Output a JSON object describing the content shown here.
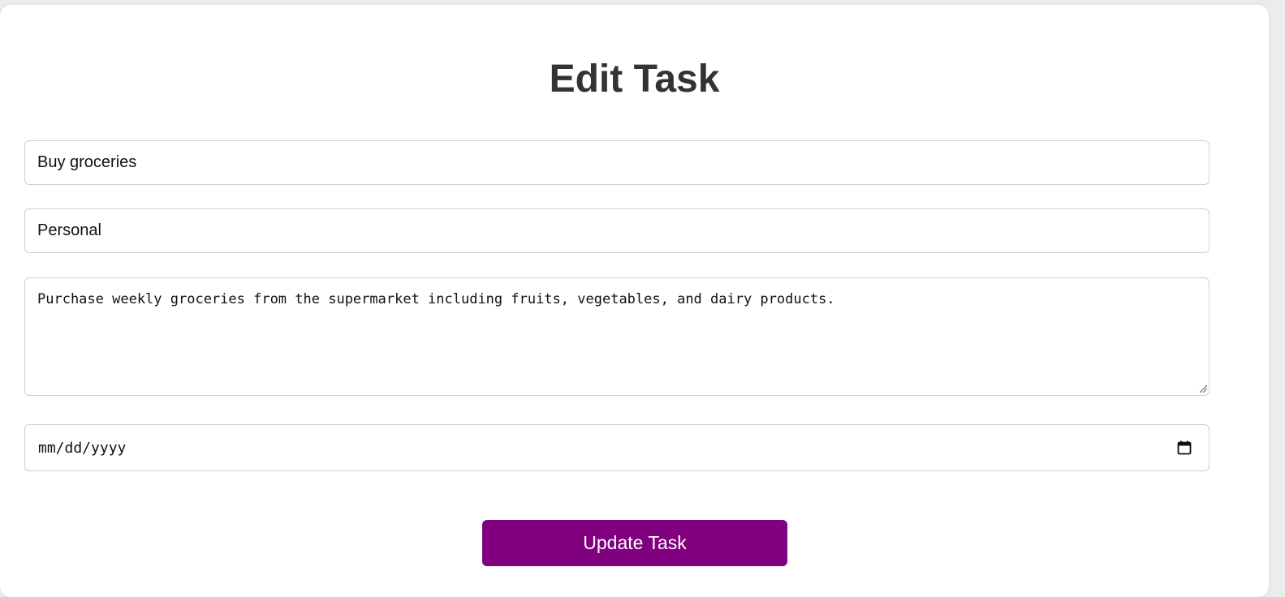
{
  "page": {
    "title": "Edit Task"
  },
  "form": {
    "task_title_value": "Buy groceries",
    "category_value": "Personal",
    "description_value": "Purchase weekly groceries from the supermarket including fruits, vegetables, and dairy products.",
    "due_date_placeholder": "mm/dd/yyyy",
    "submit_label": "Update Task"
  },
  "icons": {
    "date_picker": "calendar-icon",
    "textarea_resize": "resize-grip-icon"
  },
  "colors": {
    "accent": "#800080",
    "title_text": "#333333",
    "background": "#ececec",
    "card": "#ffffff"
  }
}
